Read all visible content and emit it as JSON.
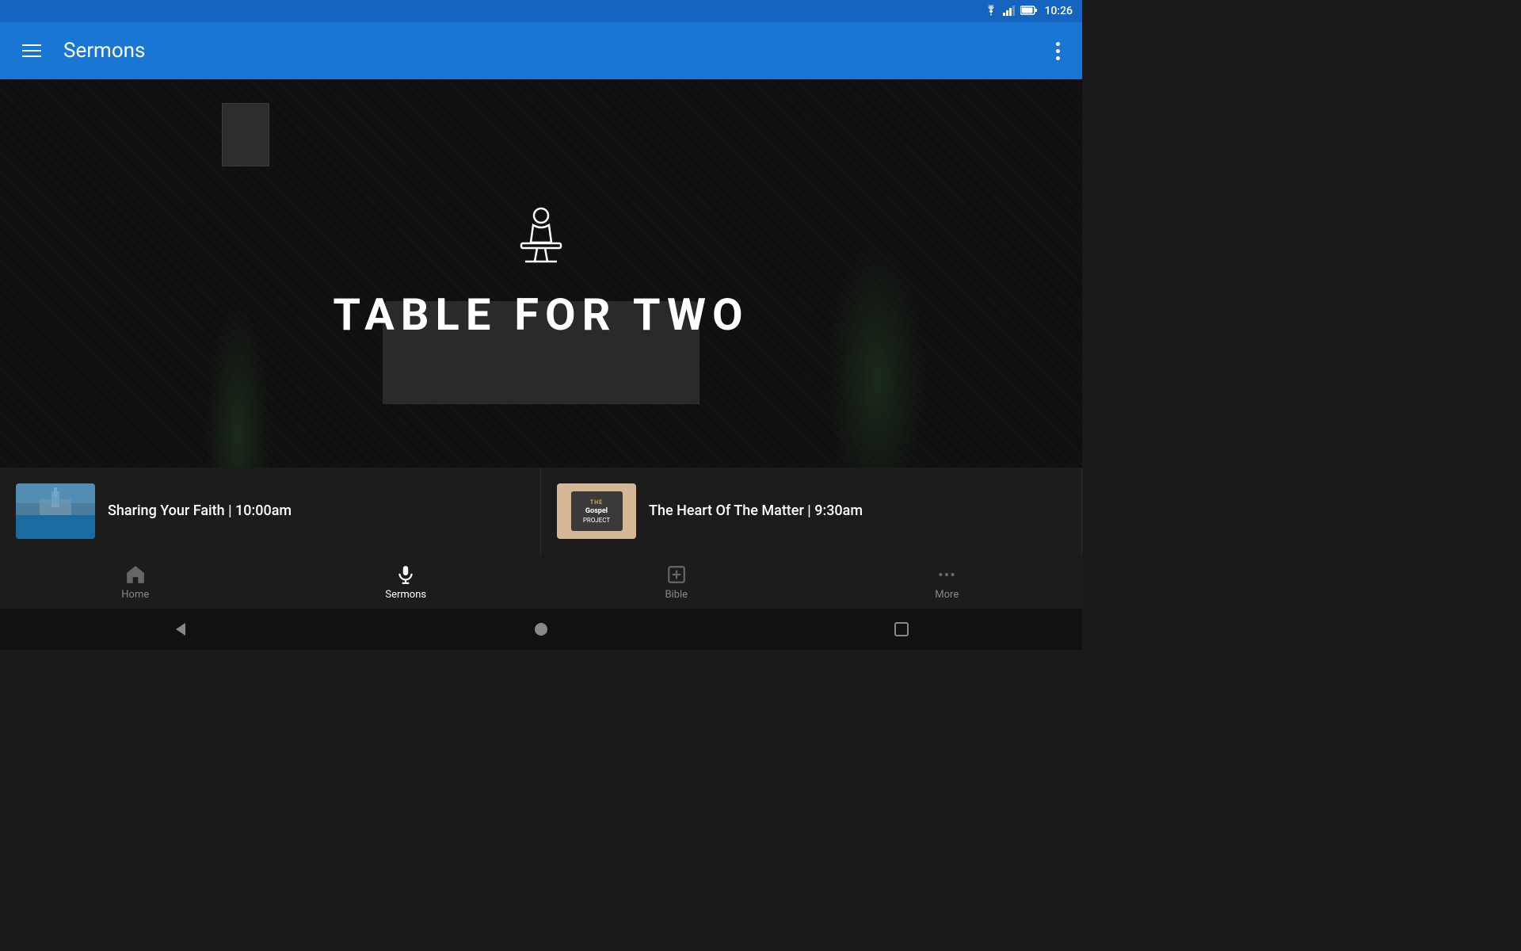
{
  "status_bar": {
    "time": "10:26",
    "wifi_label": "wifi",
    "signal_label": "signal",
    "battery_label": "battery"
  },
  "app_bar": {
    "title": "Sermons",
    "hamburger_label": "menu",
    "overflow_label": "more options"
  },
  "hero": {
    "title": "TABLE FOR TWO",
    "preacher_icon_label": "preacher-icon"
  },
  "sermon_list": {
    "items": [
      {
        "title": "Sharing Your Faith | 10:00am",
        "thumbnail_alt": "church building"
      },
      {
        "title": "The Heart Of The Matter | 9:30am",
        "thumbnail_alt": "the gospel"
      }
    ]
  },
  "bottom_nav": {
    "items": [
      {
        "label": "Home",
        "icon": "home-icon",
        "active": false
      },
      {
        "label": "Sermons",
        "icon": "microphone-icon",
        "active": true
      },
      {
        "label": "Bible",
        "icon": "bible-icon",
        "active": false
      },
      {
        "label": "More",
        "icon": "more-icon",
        "active": false
      }
    ]
  },
  "android_nav": {
    "back_label": "back",
    "home_label": "home",
    "recents_label": "recents"
  }
}
